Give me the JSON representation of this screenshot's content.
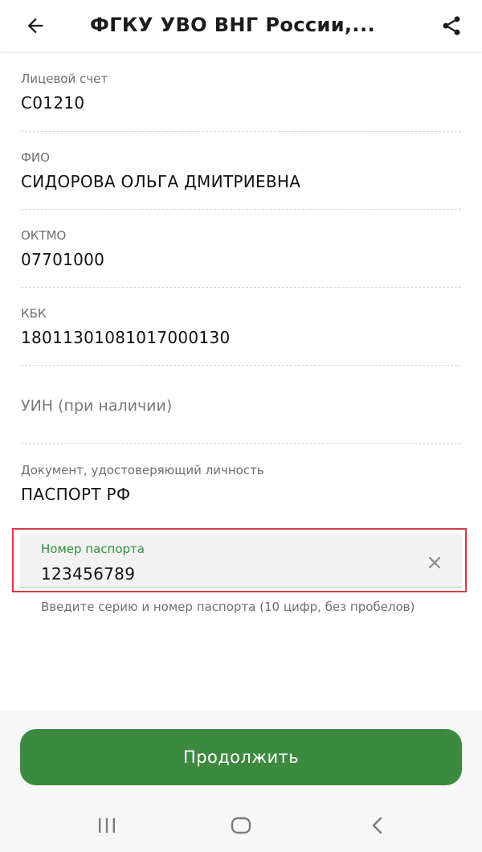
{
  "appbar": {
    "title": "ФГКУ УВО ВНГ России,..."
  },
  "fields": [
    {
      "label": "Лицевой счет",
      "value": "С01210"
    },
    {
      "label": "ФИО",
      "value": "СИДОРОВА ОЛЬГА ДМИТРИЕВНА"
    },
    {
      "label": "ОКТМО",
      "value": "07701000"
    },
    {
      "label": "КБК",
      "value": "18011301081017000130"
    },
    {
      "placeholder": "УИН (при наличии)"
    },
    {
      "label": "Документ, удостоверяющий личность",
      "value": "ПАСПОРТ РФ"
    }
  ],
  "passport_input": {
    "label": "Номер паспорта",
    "value": "123456789",
    "helper": "Введите серию и номер паспорта (10 цифр, без пробелов)"
  },
  "continue_button": {
    "label": "Продолжить"
  },
  "colors": {
    "accent_green": "#3b8a3f",
    "label_green": "#2f8c3e",
    "highlight_red": "#d93a46"
  },
  "icons": {
    "back": "arrow-left-icon",
    "share": "share-icon",
    "clear": "close-icon",
    "recents": "recents-icon",
    "home": "home-icon",
    "nav_back": "chevron-left-icon"
  }
}
